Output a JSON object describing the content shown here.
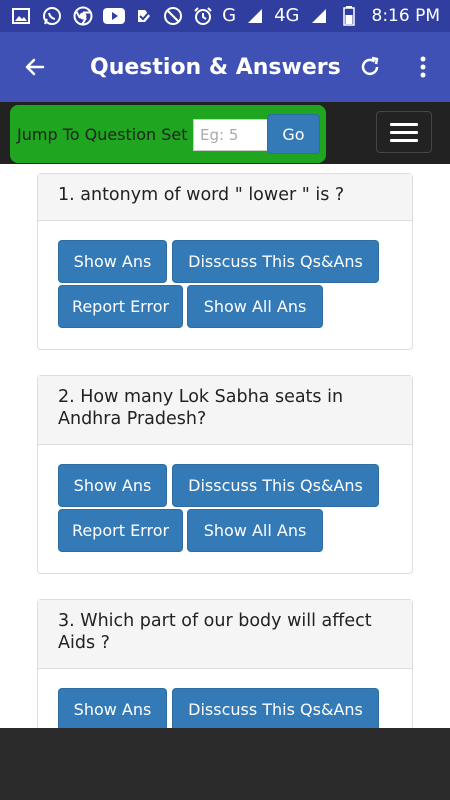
{
  "status_bar": {
    "network": "G",
    "network_4g": "4G",
    "time": "8:16 PM",
    "icons": [
      "image-icon",
      "whatsapp-icon",
      "chrome-icon",
      "youtube-icon",
      "check-icon",
      "dnd-icon",
      "alarm-icon",
      "signal-icon",
      "battery-icon"
    ]
  },
  "app_bar": {
    "title": "Question & Answers",
    "back_icon": "back-arrow-icon",
    "refresh_icon": "refresh-icon",
    "more_icon": "more-vert-icon"
  },
  "jump": {
    "label": "Jump To Question Set",
    "placeholder": "Eg: 5",
    "go_label": "Go"
  },
  "questions": [
    {
      "title": "1. antonym of word \" lower \" is ?",
      "buttons": {
        "show_ans": "Show Ans",
        "discuss": "Disscuss This Qs&Ans",
        "report": "Report Error",
        "show_all": "Show All Ans"
      }
    },
    {
      "title": "2. How many Lok Sabha seats in Andhra Pradesh?",
      "buttons": {
        "show_ans": "Show Ans",
        "discuss": "Disscuss This Qs&Ans",
        "report": "Report Error",
        "show_all": "Show All Ans"
      }
    },
    {
      "title": "3. Which part of our body will affect Aids ?",
      "buttons": {
        "show_ans": "Show Ans",
        "discuss": "Disscuss This Qs&Ans"
      }
    }
  ],
  "colors": {
    "status_bar": "#303f9f",
    "app_bar": "#3f51b5",
    "navbar": "#222222",
    "jump_box": "#1fa51f",
    "button": "#337ab7"
  }
}
